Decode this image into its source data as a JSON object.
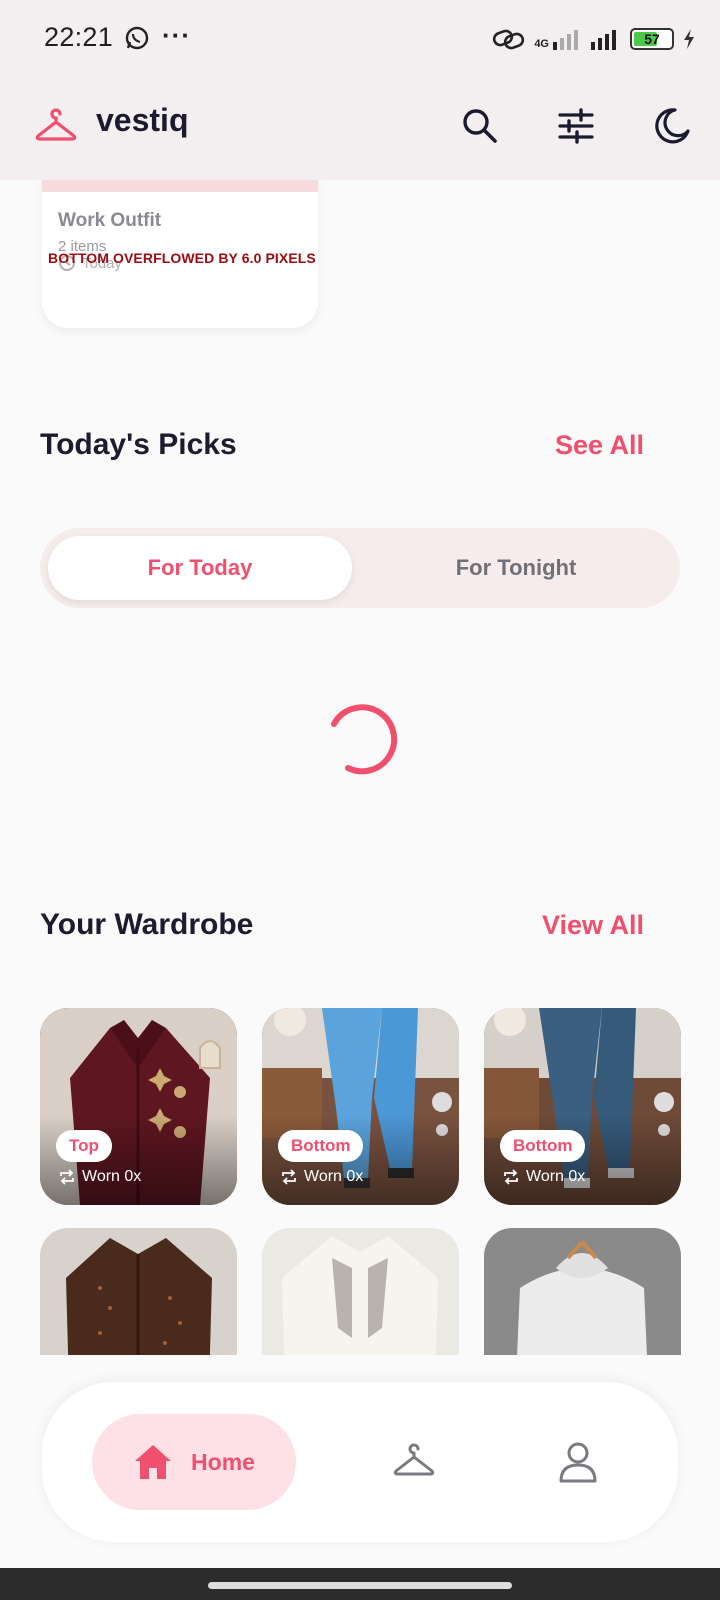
{
  "status_bar": {
    "time": "22:21",
    "more": "···",
    "network": "4G",
    "battery": "57",
    "icons": [
      "whatsapp-icon",
      "link-icon",
      "signal-icon",
      "battery-icon",
      "charging-icon"
    ]
  },
  "app_bar": {
    "title": "vestiq",
    "icons": [
      "hanger-icon",
      "search-icon",
      "filter-icon",
      "moon-icon"
    ]
  },
  "outfit_card": {
    "title": "Work Outfit",
    "items": "2 items",
    "date": "Today"
  },
  "overflow_message": "BOTTOM OVERFLOWED BY 6.0 PIXELS",
  "picks": {
    "title": "Today's Picks",
    "link": "See All",
    "tabs": [
      {
        "label": "For Today",
        "active": true
      },
      {
        "label": "For Tonight",
        "active": false
      }
    ]
  },
  "wardrobe": {
    "title": "Your Wardrobe",
    "link": "View All",
    "items": [
      {
        "category": "Top",
        "worn": "Worn 0x"
      },
      {
        "category": "Bottom",
        "worn": "Worn 0x"
      },
      {
        "category": "Bottom",
        "worn": "Worn 0x"
      }
    ]
  },
  "bottom_nav": {
    "home_label": "Home",
    "icons": [
      "home-icon",
      "hanger-icon",
      "profile-icon"
    ]
  },
  "colors": {
    "accent": "#f0506e",
    "accent_soft": "#fde1e6",
    "header_bg": "#f3eff0",
    "page_bg": "#fbfafa",
    "text_dark": "#1d1b2e"
  }
}
